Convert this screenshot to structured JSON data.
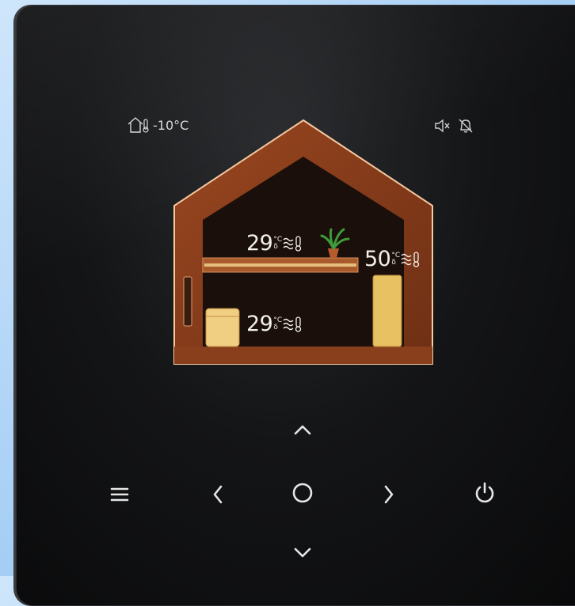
{
  "status": {
    "outdoor_temp": "-10°C",
    "icons": [
      "house-thermometer-icon",
      "speaker-muted-icon",
      "alarm-bell-off-icon"
    ]
  },
  "house": {
    "upper_zone": {
      "temp": "29",
      "unit_top": "°C",
      "unit_bottom": "δ",
      "icon": "heating-wave-thermometer-icon"
    },
    "lower_zone": {
      "temp": "29",
      "unit_top": "°C",
      "unit_bottom": "δ",
      "icon": "heating-wave-thermometer-icon"
    },
    "hot_water": {
      "temp": "50",
      "unit_top": "°C",
      "unit_bottom": "δ",
      "icon": "heating-wave-thermometer-icon"
    }
  },
  "buttons": [
    "menu-icon",
    "left-arrow-icon",
    "up-arrow-icon",
    "ok-circle-icon",
    "down-arrow-icon",
    "right-arrow-icon",
    "power-icon"
  ],
  "colors": {
    "wood": "#8a3f1c",
    "outline": "#f6c9a0",
    "panel": "#111214",
    "glyph": "#e6e6e6",
    "tank": "#e8c163"
  }
}
